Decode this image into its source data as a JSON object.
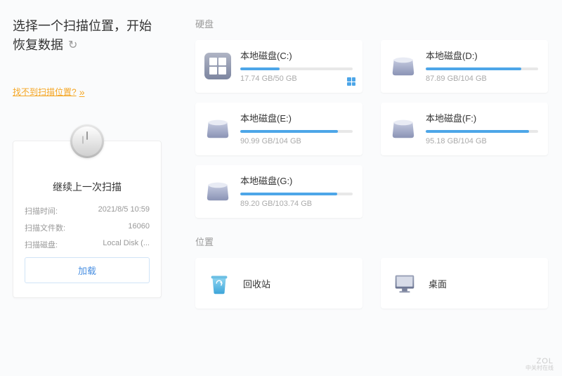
{
  "title": "选择一个扫描位置，开始恢复数据",
  "help_link": "找不到扫描位置?",
  "last_scan": {
    "title": "继续上一次扫描",
    "time_label": "扫描时间:",
    "time_value": "2021/8/5 10:59",
    "files_label": "扫描文件数:",
    "files_value": "16060",
    "disk_label": "扫描磁盘:",
    "disk_value": "Local Disk (...",
    "load_btn": "加载"
  },
  "sections": {
    "disks_label": "硬盘",
    "locations_label": "位置"
  },
  "disks": [
    {
      "name": "本地磁盘(C:)",
      "used": 17.74,
      "total": 50,
      "size_text": "17.74 GB/50 GB",
      "is_system": true,
      "pct": 35
    },
    {
      "name": "本地磁盘(D:)",
      "used": 87.89,
      "total": 104,
      "size_text": "87.89 GB/104 GB",
      "is_system": false,
      "pct": 85
    },
    {
      "name": "本地磁盘(E:)",
      "used": 90.99,
      "total": 104,
      "size_text": "90.99 GB/104 GB",
      "is_system": false,
      "pct": 87
    },
    {
      "name": "本地磁盘(F:)",
      "used": 95.18,
      "total": 104,
      "size_text": "95.18 GB/104 GB",
      "is_system": false,
      "pct": 92
    },
    {
      "name": "本地磁盘(G:)",
      "used": 89.2,
      "total": 103.74,
      "size_text": "89.20 GB/103.74 GB",
      "is_system": false,
      "pct": 86
    }
  ],
  "locations": [
    {
      "name": "回收站",
      "icon": "recycle-bin"
    },
    {
      "name": "桌面",
      "icon": "desktop"
    }
  ],
  "watermark": {
    "main": "ZOL",
    "sub": "中关村在线"
  }
}
